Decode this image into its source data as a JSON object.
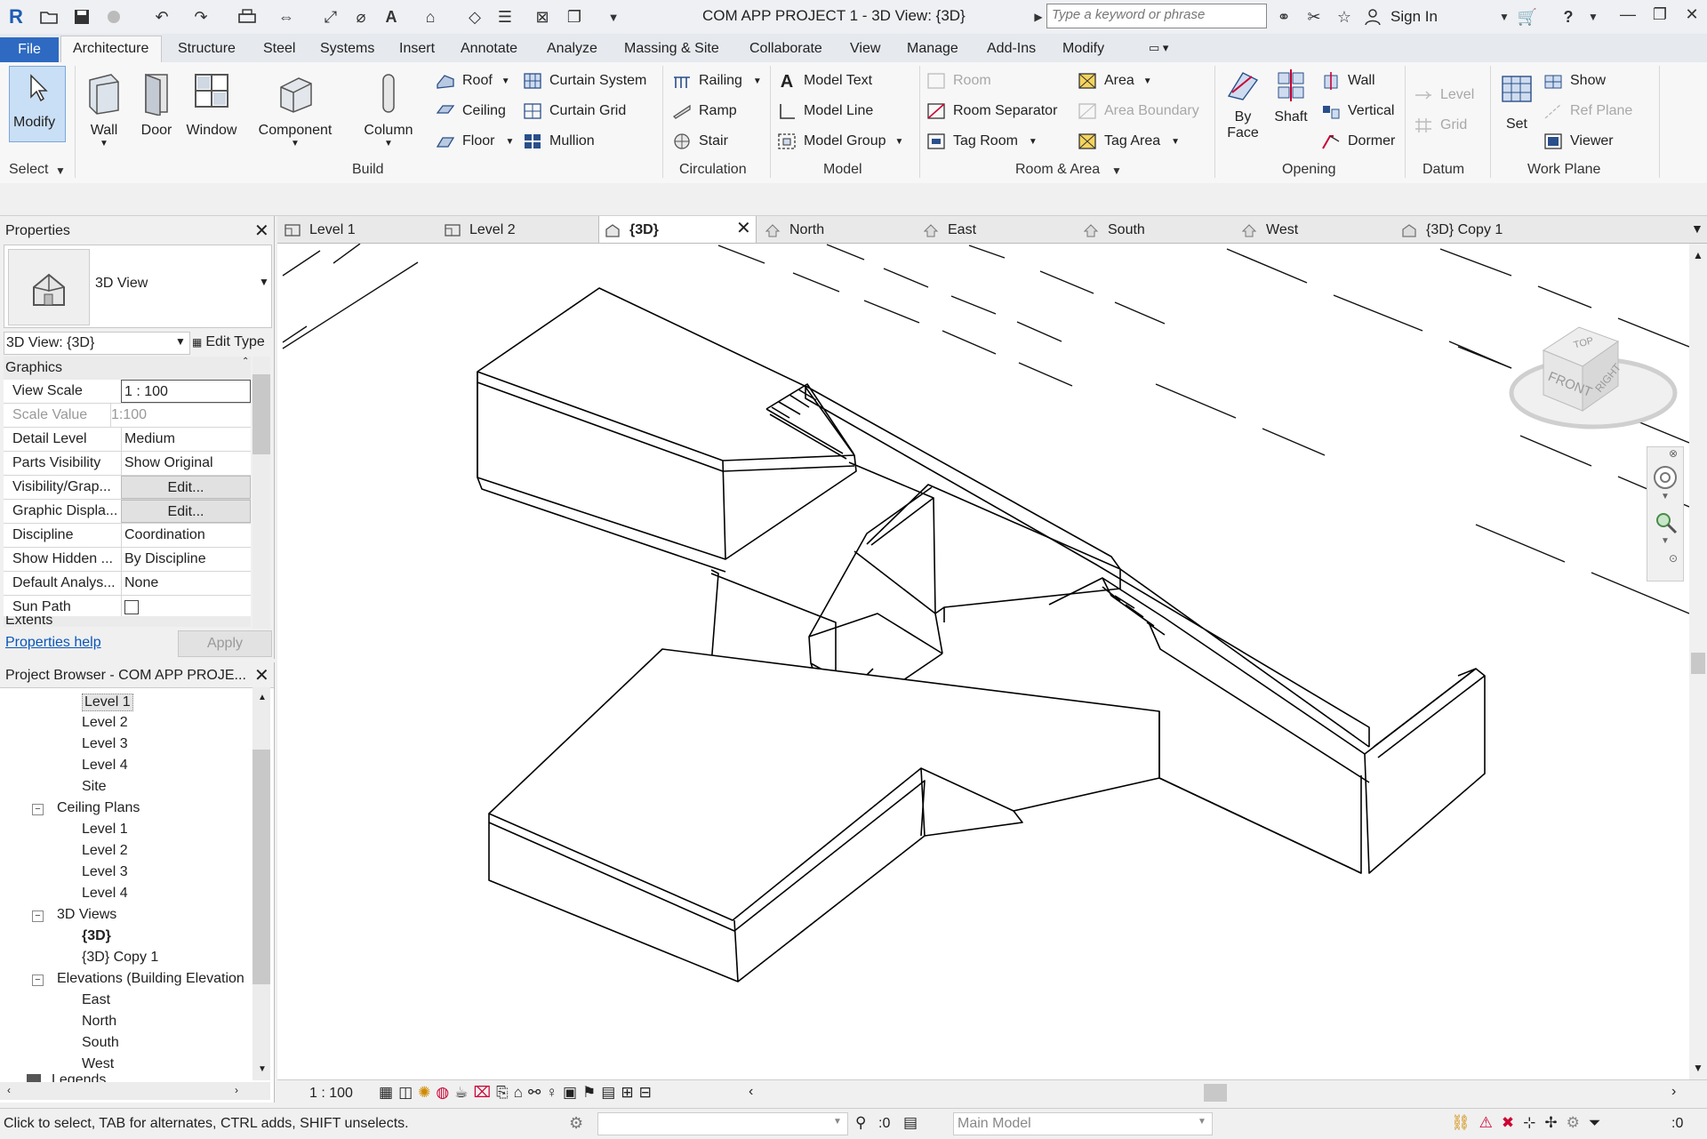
{
  "app": {
    "title": "COM APP PROJECT 1 - 3D View: {3D}",
    "search_placeholder": "Type a keyword or phrase",
    "sign_in": "Sign In",
    "logo": "R"
  },
  "ribbon_tabs": [
    "File",
    "Architecture",
    "Structure",
    "Steel",
    "Systems",
    "Insert",
    "Annotate",
    "Analyze",
    "Massing & Site",
    "Collaborate",
    "View",
    "Manage",
    "Add-Ins",
    "Modify"
  ],
  "ribbon": {
    "select": {
      "modify": "Modify",
      "label": "Select"
    },
    "build": {
      "wall": "Wall",
      "door": "Door",
      "window": "Window",
      "component": "Component",
      "column": "Column",
      "roof": "Roof",
      "ceiling": "Ceiling",
      "floor": "Floor",
      "curtain_system": "Curtain  System",
      "curtain_grid": "Curtain  Grid",
      "mullion": "Mullion",
      "label": "Build"
    },
    "circulation": {
      "railing": "Railing",
      "ramp": "Ramp",
      "stair": "Stair",
      "label": "Circulation"
    },
    "model": {
      "model_text": "Model  Text",
      "model_line": "Model  Line",
      "model_group": "Model  Group",
      "label": "Model"
    },
    "room_area": {
      "room": "Room",
      "room_separator": "Room  Separator",
      "tag_room": "Tag  Room",
      "area": "Area",
      "area_boundary": "Area  Boundary",
      "tag_area": "Tag  Area",
      "label": "Room & Area"
    },
    "opening": {
      "by_face_1": "By",
      "by_face_2": "Face",
      "shaft": "Shaft",
      "wall": "Wall",
      "vertical": "Vertical",
      "dormer": "Dormer",
      "label": "Opening"
    },
    "datum": {
      "level": "Level",
      "grid": "Grid",
      "label": "Datum"
    },
    "work_plane": {
      "set": "Set",
      "show": "Show",
      "ref_plane": "Ref  Plane",
      "viewer": "Viewer",
      "label": "Work Plane"
    }
  },
  "properties": {
    "title": "Properties",
    "type_name": "3D View",
    "selector": "3D View: {3D}",
    "edit_type": "Edit Type",
    "group": "Graphics",
    "rows": [
      {
        "k": "View Scale",
        "v": "1 : 100"
      },
      {
        "k": "Scale Value",
        "v": "1:100",
        "pre": "1:",
        "post": "100"
      },
      {
        "k": "Detail Level",
        "v": "Medium"
      },
      {
        "k": "Parts Visibility",
        "v": "Show Original"
      },
      {
        "k": "Visibility/Grap...",
        "v": "Edit..."
      },
      {
        "k": "Graphic Displa...",
        "v": "Edit..."
      },
      {
        "k": "Discipline",
        "v": "Coordination"
      },
      {
        "k": "Show Hidden ...",
        "v": "By Discipline"
      },
      {
        "k": "Default Analys...",
        "v": "None"
      },
      {
        "k": "Sun Path",
        "v": ""
      }
    ],
    "extents": "Extents",
    "help": "Properties help",
    "apply": "Apply"
  },
  "browser": {
    "title": "Project Browser - COM APP PROJE...",
    "items": [
      {
        "t": "Level 1",
        "lvl": 2
      },
      {
        "t": "Level 2",
        "lvl": 2
      },
      {
        "t": "Level 3",
        "lvl": 2
      },
      {
        "t": "Level 4",
        "lvl": 2
      },
      {
        "t": "Site",
        "lvl": 2
      },
      {
        "t": "Ceiling Plans",
        "lvl": 1
      },
      {
        "t": "Level 1",
        "lvl": 2
      },
      {
        "t": "Level 2",
        "lvl": 2
      },
      {
        "t": "Level 3",
        "lvl": 2
      },
      {
        "t": "Level 4",
        "lvl": 2
      },
      {
        "t": "3D Views",
        "lvl": 1
      },
      {
        "t": "{3D}",
        "lvl": 2
      },
      {
        "t": "{3D} Copy 1",
        "lvl": 2
      },
      {
        "t": "Elevations (Building Elevation",
        "lvl": 1
      },
      {
        "t": "East",
        "lvl": 2
      },
      {
        "t": "North",
        "lvl": 2
      },
      {
        "t": "South",
        "lvl": 2
      },
      {
        "t": "West",
        "lvl": 2
      },
      {
        "t": "Legends",
        "lvl": 0
      }
    ]
  },
  "view_tabs": [
    "Level 1",
    "Level 2",
    "{3D}",
    "North",
    "East",
    "South",
    "West",
    "{3D} Copy 1"
  ],
  "viewcube": {
    "top": "TOP",
    "front": "FRONT",
    "right": "RIGHT"
  },
  "view_bar": {
    "scale": "1 : 100"
  },
  "status": {
    "hint": "Click to select, TAB for alternates, CTRL adds, SHIFT unselects.",
    "count1": ":0",
    "model": "Main Model",
    "count2": ":0"
  }
}
